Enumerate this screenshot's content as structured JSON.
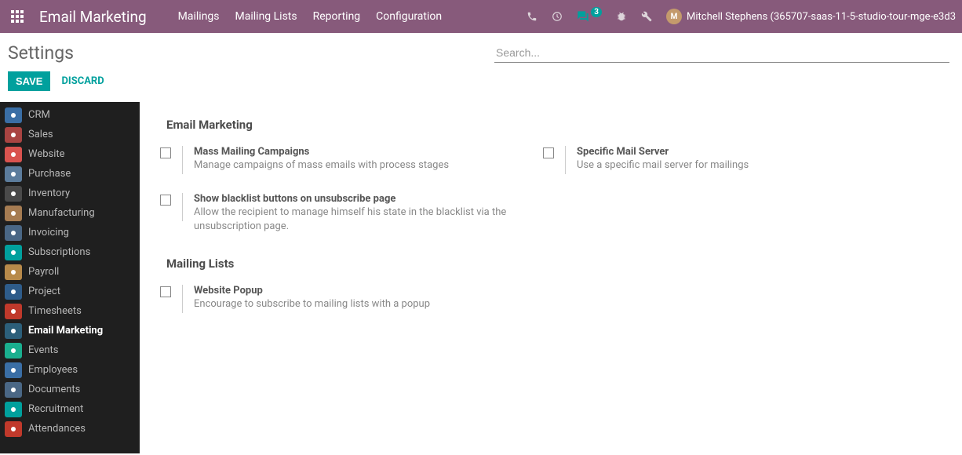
{
  "topbar": {
    "app_title": "Email Marketing",
    "menu": [
      "Mailings",
      "Mailing Lists",
      "Reporting",
      "Configuration"
    ],
    "badge": "3",
    "user": "Mitchell Stephens (365707-saas-11-5-studio-tour-mge-e3d3"
  },
  "header": {
    "title": "Settings",
    "search_placeholder": "Search..."
  },
  "actions": {
    "save": "SAVE",
    "discard": "DISCARD"
  },
  "sidebar": {
    "items": [
      "CRM",
      "Sales",
      "Website",
      "Purchase",
      "Inventory",
      "Manufacturing",
      "Invoicing",
      "Subscriptions",
      "Payroll",
      "Project",
      "Timesheets",
      "Email Marketing",
      "Events",
      "Employees",
      "Documents",
      "Recruitment",
      "Attendances"
    ],
    "icon_colors": [
      "#3a6ea5",
      "#a94442",
      "#d9534f",
      "#5c7c9c",
      "#4a4a4a",
      "#a67c52",
      "#4a6785",
      "#00a09d",
      "#b88a4a",
      "#2e5c8a",
      "#c0392b",
      "#2c5f7a",
      "#1aaf8f",
      "#3a6ea5",
      "#4a6785",
      "#00a09d",
      "#c0392b"
    ]
  },
  "sections": [
    {
      "title": "Email Marketing",
      "rows": [
        [
          {
            "label": "Mass Mailing Campaigns",
            "desc": "Manage campaigns of mass emails with process stages"
          },
          {
            "label": "Specific Mail Server",
            "desc": "Use a specific mail server for mailings"
          }
        ],
        [
          {
            "label": "Show blacklist buttons on unsubscribe page",
            "desc": "Allow the recipient to manage himself his state in the blacklist via the unsubscription page."
          }
        ]
      ]
    },
    {
      "title": "Mailing Lists",
      "rows": [
        [
          {
            "label": "Website Popup",
            "desc": "Encourage to subscribe to mailing lists with a popup"
          }
        ]
      ]
    }
  ]
}
